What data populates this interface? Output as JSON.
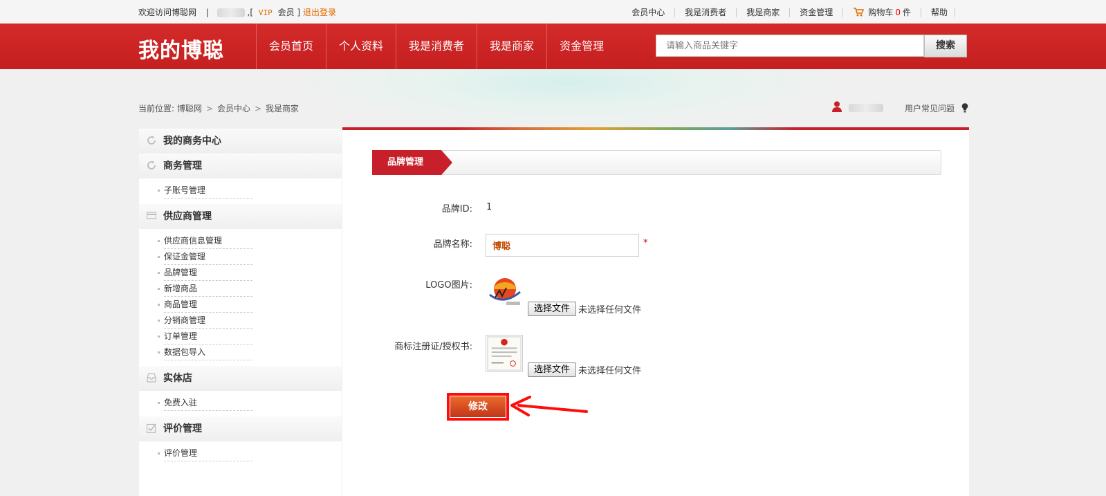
{
  "topbar": {
    "welcome": "欢迎访问博聪网",
    "separator": "|",
    "bracket_open": ",[",
    "vip": "VIP",
    "member": "会员",
    "bracket_close": "]",
    "logout": "退出登录",
    "links": [
      "会员中心",
      "我是消费者",
      "我是商家",
      "资金管理"
    ],
    "cart_label": "购物车",
    "cart_count": "0",
    "cart_unit": "件",
    "help": "帮助"
  },
  "nav": {
    "logo": "我的博聪",
    "items": [
      "会员首页",
      "个人资料",
      "我是消费者",
      "我是商家",
      "资金管理"
    ],
    "search_placeholder": "请输入商品关键字",
    "search_button": "搜索"
  },
  "breadcrumb": {
    "prefix": "当前位置:",
    "items": [
      "博聪网",
      "会员中心",
      "我是商家"
    ],
    "separator": ">"
  },
  "faq": "用户常见问题",
  "sidebar": {
    "title": "我的商务中心",
    "sections": [
      {
        "title": "商务管理",
        "items": [
          "子账号管理"
        ]
      },
      {
        "title": "供应商管理",
        "items": [
          "供应商信息管理",
          "保证金管理",
          "品牌管理",
          "新增商品",
          "商品管理",
          "分销商管理",
          "订单管理",
          "数据包导入"
        ]
      },
      {
        "title": "实体店",
        "items": [
          "免费入驻"
        ]
      },
      {
        "title": "评价管理",
        "items": [
          "评价管理"
        ]
      }
    ]
  },
  "main": {
    "tab": "品牌管理",
    "brand_id_label": "品牌ID:",
    "brand_id_value": "1",
    "brand_name_label": "品牌名称:",
    "brand_name_value": "博聪",
    "required_mark": "*",
    "logo_label": "LOGO图片:",
    "trademark_label": "商标注册证/授权书:",
    "file_button": "选择文件",
    "no_file": "未选择任何文件",
    "submit": "修改"
  },
  "colors": {
    "brand_red": "#c8202a",
    "accent_orange": "#e26b00",
    "highlight_red": "#ff0d0d"
  }
}
